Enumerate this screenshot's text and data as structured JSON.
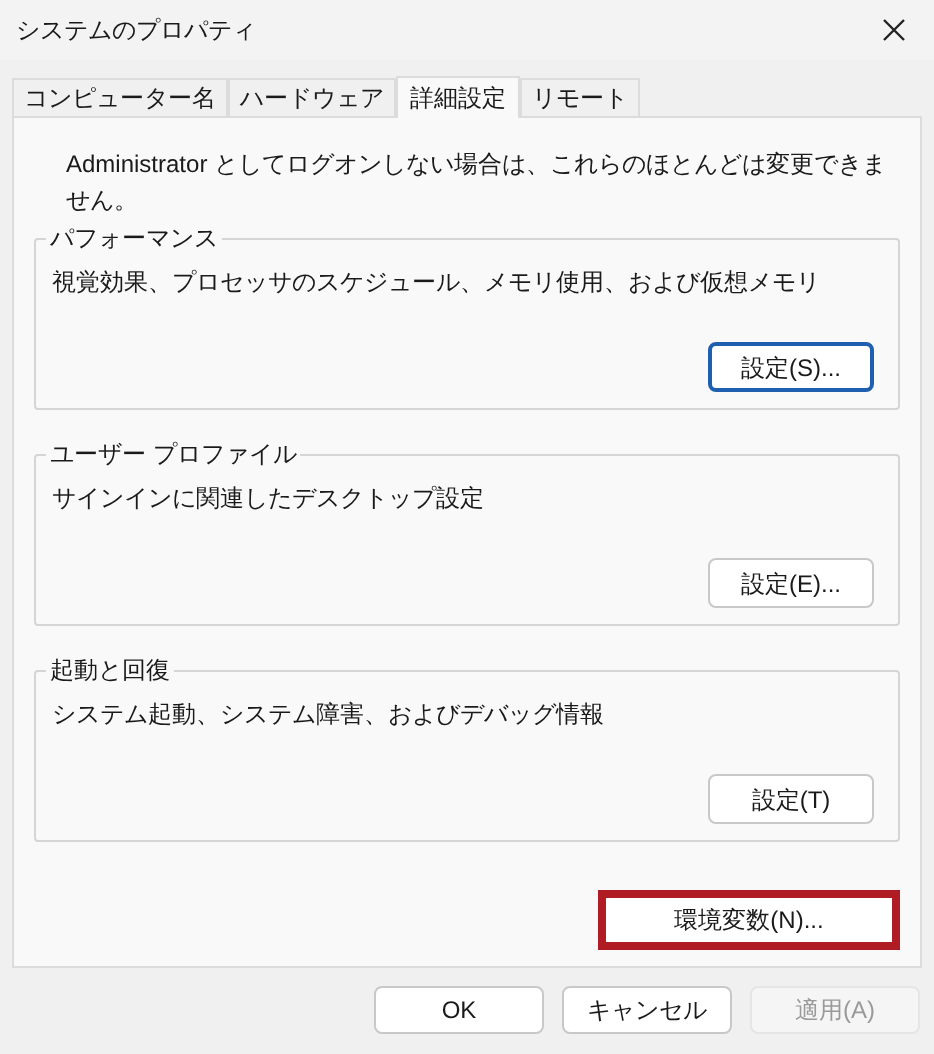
{
  "window": {
    "title": "システムのプロパティ"
  },
  "tabs": [
    {
      "label": "コンピューター名",
      "selected": false
    },
    {
      "label": "ハードウェア",
      "selected": false
    },
    {
      "label": "詳細設定",
      "selected": true
    },
    {
      "label": "リモート",
      "selected": false
    }
  ],
  "notice": "Administrator としてログオンしない場合は、これらのほとんどは変更できません。",
  "groups": [
    {
      "title": "パフォーマンス",
      "description": "視覚効果、プロセッサのスケジュール、メモリ使用、および仮想メモリ",
      "button": {
        "label": "設定(S)...",
        "focused": true
      }
    },
    {
      "title": "ユーザー プロファイル",
      "description": "サインインに関連したデスクトップ設定",
      "button": {
        "label": "設定(E)...",
        "focused": false
      }
    },
    {
      "title": "起動と回復",
      "description": "システム起動、システム障害、およびデバッグ情報",
      "button": {
        "label": "設定(T)",
        "focused": false
      }
    }
  ],
  "environment_button": {
    "label": "環境変数(N)...",
    "highlighted": true
  },
  "buttons": [
    {
      "label": "OK",
      "disabled": false
    },
    {
      "label": "キャンセル",
      "disabled": false
    },
    {
      "label": "適用(A)",
      "disabled": true
    }
  ]
}
